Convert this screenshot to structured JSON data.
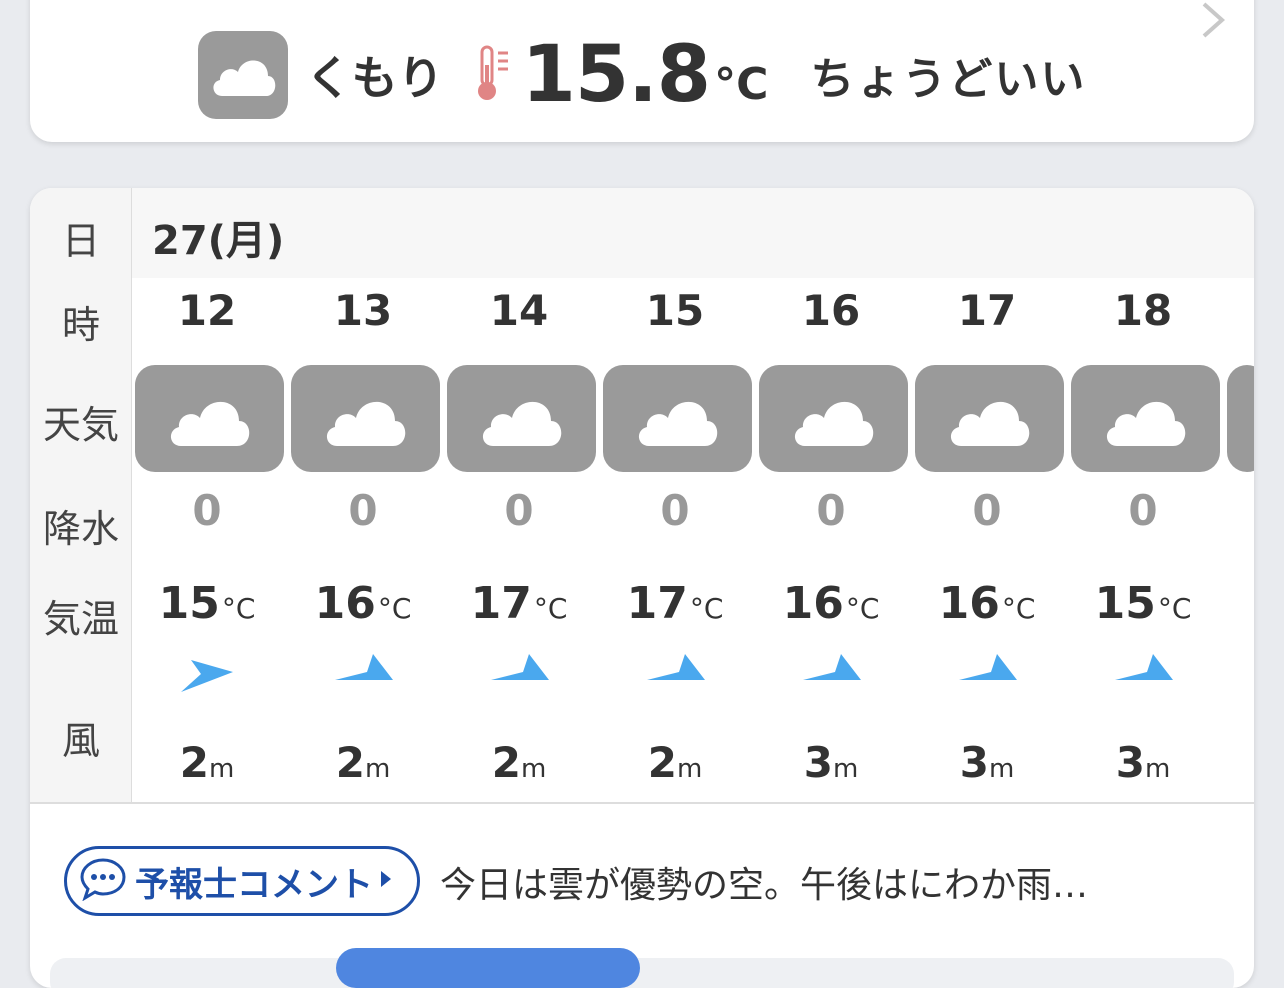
{
  "current": {
    "weather": "くもり",
    "weather_icon": "cloud-icon",
    "temperature": "15.8",
    "unit": "°C",
    "feel": "ちょうどいい"
  },
  "forecast": {
    "labels": {
      "day": "日",
      "hour": "時",
      "weather": "天気",
      "precip": "降水",
      "temp": "気温",
      "wind": "風"
    },
    "date": "27(月)",
    "hours": [
      {
        "hour": "12",
        "precip": "0",
        "temp": "15",
        "wind": "2"
      },
      {
        "hour": "13",
        "precip": "0",
        "temp": "16",
        "wind": "2"
      },
      {
        "hour": "14",
        "precip": "0",
        "temp": "17",
        "wind": "2"
      },
      {
        "hour": "15",
        "precip": "0",
        "temp": "17",
        "wind": "2"
      },
      {
        "hour": "16",
        "precip": "0",
        "temp": "16",
        "wind": "3"
      },
      {
        "hour": "17",
        "precip": "0",
        "temp": "16",
        "wind": "3"
      },
      {
        "hour": "18",
        "precip": "0",
        "temp": "15",
        "wind": "3"
      }
    ],
    "temp_unit": "°C",
    "wind_unit": "m"
  },
  "comment": {
    "label": "予報士コメント",
    "text": "今日は雲が優勢の空。午後はにわか雨…"
  },
  "colors": {
    "accent": "#1e4fa8",
    "wind_arrow": "#4aa8ee",
    "icon_bg": "#9a9a9a"
  }
}
